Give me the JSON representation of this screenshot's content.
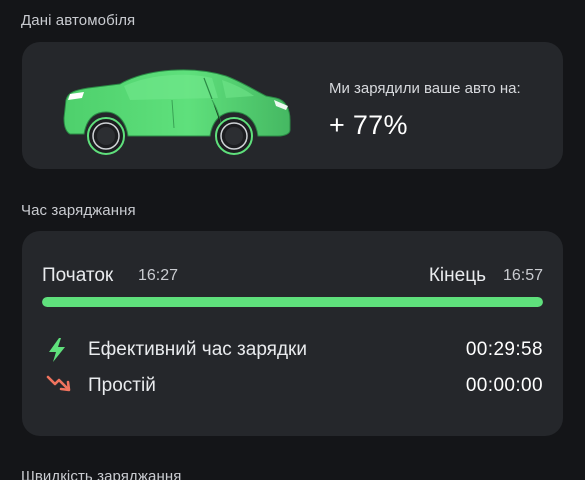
{
  "car_section": {
    "title": "Дані автомобіля",
    "charged_caption": "Ми зарядили ваше авто на:",
    "charged_value": "+ 77%",
    "car_color": "#5fe07c"
  },
  "time_section": {
    "title": "Час заряджання",
    "start_label": "Початок",
    "start_time": "16:27",
    "end_label": "Кінець",
    "end_time": "16:57",
    "progress_percent": 100,
    "effective": {
      "icon": "lightning-icon",
      "label": "Ефективний час зарядки",
      "value": "00:29:58",
      "color": "#5fe07c"
    },
    "idle": {
      "icon": "trend-down-icon",
      "label": "Простій",
      "value": "00:00:00",
      "color": "#f0735e"
    }
  },
  "speed_section": {
    "title": "Швидкість заряджання"
  }
}
